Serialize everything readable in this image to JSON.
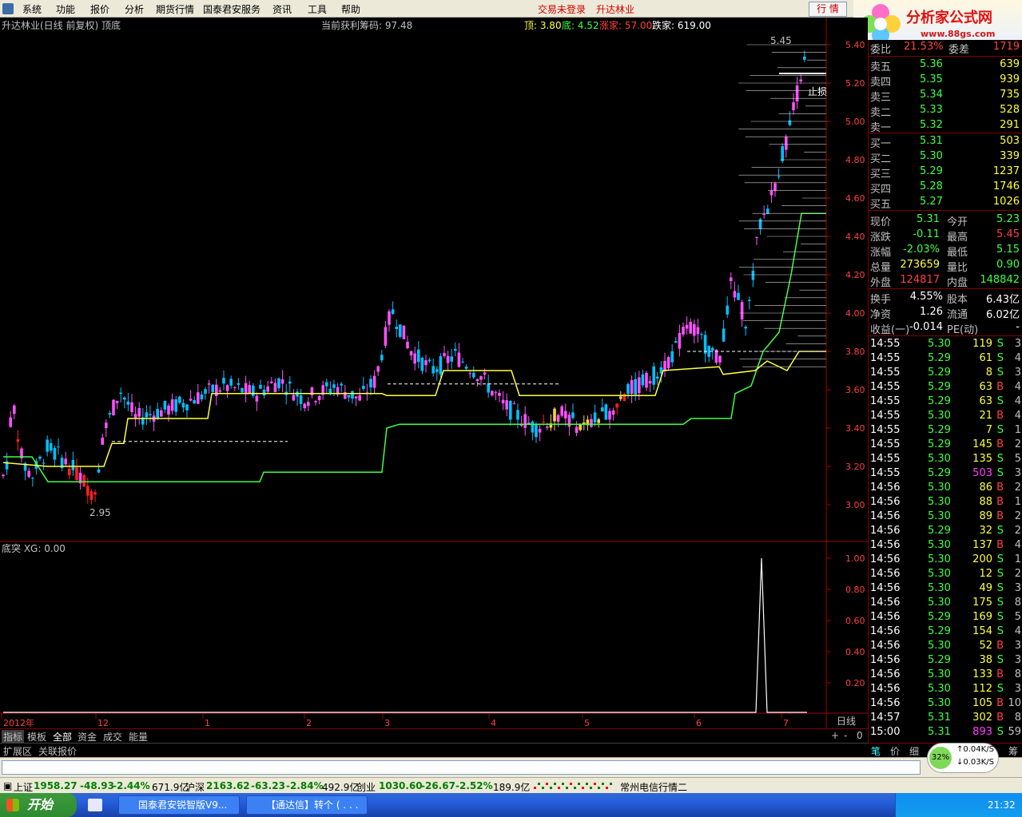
{
  "menu": {
    "items": [
      "系统",
      "功能",
      "报价",
      "分析",
      "期货行情",
      "国泰君安服务",
      "资讯",
      "工具",
      "帮助"
    ],
    "status_not_logged": "交易未登录",
    "stock_name": "升达林业",
    "quote_button": "行 情"
  },
  "logo": {
    "text": "分析家公式网",
    "url": "www.88gs.com"
  },
  "chart": {
    "title": "升达林业(日线 前复权) 顶底",
    "profit_label": "当前获利筹码: 97.48",
    "top_label": "顶: 3.80",
    "bottom_label": "底: 4.52",
    "limit_up": "涨家: 57.00",
    "limit_down": "跌家: 619.00",
    "max_label": "5.45",
    "min_label": "2.95",
    "stop_label": "止损",
    "price_ticks": [
      "5.40",
      "5.20",
      "5.00",
      "4.80",
      "4.60",
      "4.40",
      "4.20",
      "4.00",
      "3.80",
      "3.60",
      "3.40",
      "3.20",
      "3.00"
    ],
    "x_labels": [
      "2012年",
      "12",
      "1",
      "2",
      "3",
      "4",
      "5",
      "6",
      "7"
    ],
    "period_label": "日线"
  },
  "indicator": {
    "title": "底突  XG: 0.00",
    "ticks": [
      "1.00",
      "0.80",
      "0.60",
      "0.40",
      "0.20"
    ]
  },
  "colors": {
    "up": "#ff50ff",
    "down": "#00c0ff",
    "red": "#ff2020",
    "yellow": "#ffff40",
    "green": "#40ff40",
    "white": "#ffffff",
    "axis": "#a00000"
  },
  "quote": {
    "ratio_label": "委比",
    "ratio_value": "21.53%",
    "diff_label": "委差",
    "diff_value": "1719",
    "sell": [
      {
        "label": "卖五",
        "price": "5.36",
        "vol": "639"
      },
      {
        "label": "卖四",
        "price": "5.35",
        "vol": "939"
      },
      {
        "label": "卖三",
        "price": "5.34",
        "vol": "735"
      },
      {
        "label": "卖二",
        "price": "5.33",
        "vol": "528"
      },
      {
        "label": "卖一",
        "price": "5.32",
        "vol": "291"
      }
    ],
    "buy": [
      {
        "label": "买一",
        "price": "5.31",
        "vol": "503"
      },
      {
        "label": "买二",
        "price": "5.30",
        "vol": "339"
      },
      {
        "label": "买三",
        "price": "5.29",
        "vol": "1237"
      },
      {
        "label": "买四",
        "price": "5.28",
        "vol": "1746"
      },
      {
        "label": "买五",
        "price": "5.27",
        "vol": "1026"
      }
    ],
    "stats": [
      {
        "l1": "现价",
        "v1": "5.31",
        "c1": "#40ff40",
        "l2": "今开",
        "v2": "5.23",
        "c2": "#40ff40"
      },
      {
        "l1": "涨跌",
        "v1": "-0.11",
        "c1": "#40ff40",
        "l2": "最高",
        "v2": "5.45",
        "c2": "#ff4040"
      },
      {
        "l1": "涨幅",
        "v1": "-2.03%",
        "c1": "#40ff40",
        "l2": "最低",
        "v2": "5.15",
        "c2": "#40ff40"
      },
      {
        "l1": "总量",
        "v1": "273659",
        "c1": "#ffff40",
        "l2": "量比",
        "v2": "0.90",
        "c2": "#40ff40"
      },
      {
        "l1": "外盘",
        "v1": "124817",
        "c1": "#ff4040",
        "l2": "内盘",
        "v2": "148842",
        "c2": "#40ff40"
      }
    ],
    "stats2": [
      {
        "l1": "换手",
        "v1": "4.55%",
        "l2": "股本",
        "v2": "6.43亿"
      },
      {
        "l1": "净资",
        "v1": "1.26",
        "l2": "流通",
        "v2": "6.02亿"
      },
      {
        "l1": "收益(一)",
        "v1": "-0.014",
        "l2": "PE(动)",
        "v2": "-"
      }
    ]
  },
  "ticks": [
    [
      "14:55",
      "5.30",
      "119",
      "S",
      "3"
    ],
    [
      "14:55",
      "5.29",
      "61",
      "S",
      "4"
    ],
    [
      "14:55",
      "5.29",
      "8",
      "S",
      "3"
    ],
    [
      "14:55",
      "5.29",
      "63",
      "B",
      "4"
    ],
    [
      "14:55",
      "5.29",
      "63",
      "S",
      "4"
    ],
    [
      "14:55",
      "5.30",
      "21",
      "B",
      "4"
    ],
    [
      "14:55",
      "5.29",
      "7",
      "S",
      "1"
    ],
    [
      "14:55",
      "5.29",
      "145",
      "B",
      "2"
    ],
    [
      "14:55",
      "5.30",
      "135",
      "S",
      "5"
    ],
    [
      "14:55",
      "5.29",
      "503",
      "S",
      "3"
    ],
    [
      "14:56",
      "5.30",
      "86",
      "B",
      "2"
    ],
    [
      "14:56",
      "5.30",
      "88",
      "B",
      "1"
    ],
    [
      "14:56",
      "5.30",
      "89",
      "B",
      "2"
    ],
    [
      "14:56",
      "5.29",
      "32",
      "S",
      "2"
    ],
    [
      "14:56",
      "5.30",
      "137",
      "B",
      "4"
    ],
    [
      "14:56",
      "5.30",
      "200",
      "S",
      "1"
    ],
    [
      "14:56",
      "5.30",
      "12",
      "S",
      "2"
    ],
    [
      "14:56",
      "5.30",
      "49",
      "S",
      "3"
    ],
    [
      "14:56",
      "5.30",
      "175",
      "S",
      "8"
    ],
    [
      "14:56",
      "5.29",
      "169",
      "S",
      "5"
    ],
    [
      "14:56",
      "5.29",
      "154",
      "S",
      "4"
    ],
    [
      "14:56",
      "5.30",
      "52",
      "B",
      "3"
    ],
    [
      "14:56",
      "5.29",
      "38",
      "S",
      "3"
    ],
    [
      "14:56",
      "5.30",
      "133",
      "B",
      "8"
    ],
    [
      "14:56",
      "5.30",
      "112",
      "S",
      "3"
    ],
    [
      "14:56",
      "5.30",
      "105",
      "B",
      "10"
    ],
    [
      "14:57",
      "5.31",
      "302",
      "B",
      "8"
    ],
    [
      "15:00",
      "5.31",
      "893",
      "S",
      "59"
    ]
  ],
  "tabs": [
    "指标",
    "模板",
    "全部",
    "资金",
    "成交",
    "能量"
  ],
  "subtabs": [
    "扩展区",
    "关联报价"
  ],
  "zoom_buttons": [
    "+",
    "-",
    "0"
  ],
  "right_tabs": [
    "笔",
    "价",
    "细",
    "",
    "筹"
  ],
  "speed": {
    "percent": "32%",
    "up": "0.04K/S",
    "down": "0.03K/S"
  },
  "status": {
    "sh_label": "上证",
    "sh_val": "1958.27",
    "sh_chg": "-48.93",
    "sh_pct": "-2.44%",
    "sh_amt": "671.9亿",
    "hs_label": "沪深",
    "hs_val": "2163.62",
    "hs_chg": "-63.23",
    "hs_pct": "-2.84%",
    "hs_amt": "492.9亿",
    "cy_label": "创业",
    "cy_val": "1030.60",
    "cy_chg": "-26.67",
    "cy_pct": "-2.52%",
    "cy_amt": "189.9亿",
    "server": "常州电信行情二"
  },
  "taskbar": {
    "start": "开始",
    "tasks": [
      "国泰君安锐智版V9...",
      "【通达信】转个 ( . . ."
    ],
    "clock": "21:32"
  }
}
